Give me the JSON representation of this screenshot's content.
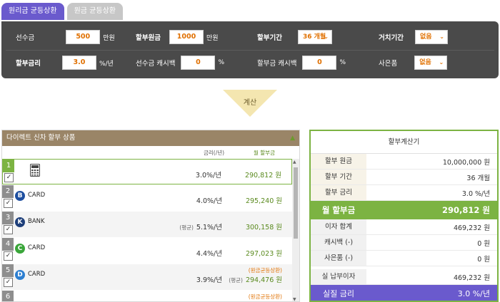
{
  "tabs": [
    {
      "label": "원리금 균등상환",
      "active": true
    },
    {
      "label": "원금 균등상환",
      "active": false
    }
  ],
  "form": {
    "advance": {
      "label": "선수금",
      "value": "500",
      "unit": "만원"
    },
    "principal": {
      "label": "할부원금",
      "value": "1000",
      "unit": "만원"
    },
    "period": {
      "label": "할부기간",
      "value": "36 개월"
    },
    "grace": {
      "label": "거치기간",
      "value": "없음"
    },
    "rate": {
      "label": "할부금리",
      "value": "3.0",
      "unit": "%/년"
    },
    "advance_cashback": {
      "label": "선수금 캐시백",
      "value": "0",
      "unit": "%"
    },
    "installment_cashback": {
      "label": "할부금 캐시백",
      "value": "0",
      "unit": "%"
    },
    "gift": {
      "label": "사은품",
      "value": "없음"
    }
  },
  "calc_button": "계산",
  "products": {
    "title": "다이렉트 신차 할부 상품",
    "collapse_icon": "chevron-up-icon",
    "col_rate": "금리(/년)",
    "col_monthly": "월 할부금",
    "rows": [
      {
        "num": "1",
        "name": "",
        "logo": "",
        "logo_color": "",
        "avg": "",
        "rate": "3.0%/년",
        "note": "",
        "monthly": "290,812 원"
      },
      {
        "num": "2",
        "name": "CARD",
        "logo": "B",
        "logo_color": "#1e4fa0",
        "avg": "",
        "rate": "4.0%/년",
        "note": "",
        "monthly": "295,240 원"
      },
      {
        "num": "3",
        "name": "BANK",
        "logo": "K",
        "logo_color": "#1e3f7a",
        "avg": "(평균)",
        "rate": "5.1%/년",
        "note": "",
        "monthly": "300,158 원"
      },
      {
        "num": "4",
        "name": "CARD",
        "logo": "C",
        "logo_color": "#3aa63a",
        "avg": "",
        "rate": "4.4%/년",
        "note": "",
        "monthly": "297,023 원"
      },
      {
        "num": "5",
        "name": "CARD",
        "logo": "D",
        "logo_color": "#2d7fd1",
        "avg": "",
        "rate": "3.9%/년",
        "note": "(원금균등상환)",
        "monthly_prefix": "(평균)",
        "monthly": "294,476 원"
      },
      {
        "num": "6",
        "name": "",
        "logo": "",
        "logo_color": "#f0c000",
        "avg": "",
        "rate": "",
        "note": "(원금균등상환)",
        "monthly": ""
      }
    ]
  },
  "summary": {
    "title": "할부계산기",
    "rows": [
      {
        "label": "할부 원금",
        "value": "10,000,000 원"
      },
      {
        "label": "할부 기간",
        "value": "36 개월"
      },
      {
        "label": "할부 금리",
        "value": "3.0 %/년"
      }
    ],
    "monthly": {
      "label": "월 할부금",
      "value": "290,812 원"
    },
    "details": [
      {
        "label": "이자 합계",
        "value": "469,232 원"
      },
      {
        "label": "캐시백 (-)",
        "value": "0 원"
      },
      {
        "label": "사은품 (-)",
        "value": "0 원"
      }
    ],
    "actual": {
      "label": "실 납부이자",
      "value": "469,232 원"
    },
    "real_rate": {
      "label": "실질 금리",
      "value": "3.0 %/년"
    }
  }
}
